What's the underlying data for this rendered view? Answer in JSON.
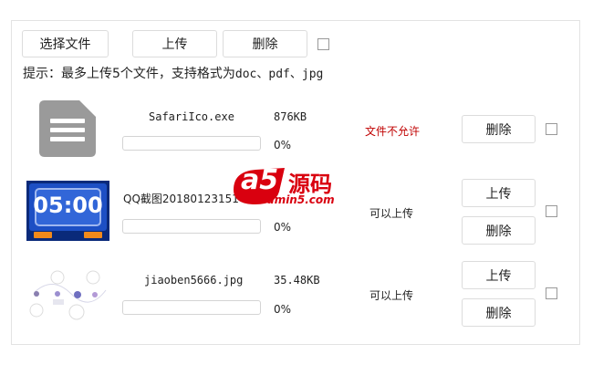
{
  "toolbar": {
    "select_label": "选择文件",
    "upload_label": "上传",
    "delete_label": "删除"
  },
  "hint": {
    "prefix": "提示：最多上传5个文件，支持格式为",
    "formats": "doc、pdf、jpg"
  },
  "files": [
    {
      "name": "SafariIco.exe",
      "size": "876KB",
      "progress_label": "0%",
      "progress": 0,
      "status": "文件不允许",
      "status_color": "#c00000",
      "delete_label": "删除",
      "thumb_icon": "document-icon"
    },
    {
      "name": "QQ截图20180123151",
      "size": "",
      "progress_label": "0%",
      "progress": 0,
      "status": "可以上传",
      "status_color": "#222222",
      "upload_label": "上传",
      "delete_label": "删除",
      "thumb_text": "05:00"
    },
    {
      "name": "jiaoben5666.jpg",
      "size": "35.48KB",
      "progress_label": "0%",
      "progress": 0,
      "status": "可以上传",
      "status_color": "#222222",
      "upload_label": "上传",
      "delete_label": "删除"
    }
  ],
  "watermark": {
    "logo": "a5",
    "brand": "源码",
    "domain": "admin5.com",
    "color": "#d9000f"
  }
}
